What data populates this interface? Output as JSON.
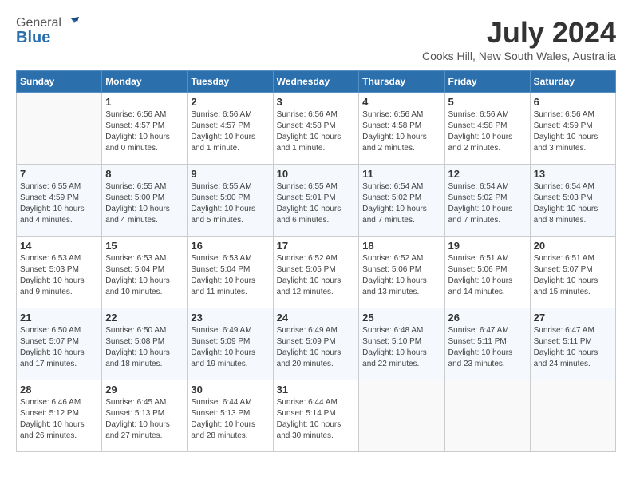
{
  "header": {
    "logo_general": "General",
    "logo_blue": "Blue",
    "month_year": "July 2024",
    "location": "Cooks Hill, New South Wales, Australia"
  },
  "columns": [
    "Sunday",
    "Monday",
    "Tuesday",
    "Wednesday",
    "Thursday",
    "Friday",
    "Saturday"
  ],
  "weeks": [
    [
      {
        "day": "",
        "info": ""
      },
      {
        "day": "1",
        "info": "Sunrise: 6:56 AM\nSunset: 4:57 PM\nDaylight: 10 hours\nand 0 minutes."
      },
      {
        "day": "2",
        "info": "Sunrise: 6:56 AM\nSunset: 4:57 PM\nDaylight: 10 hours\nand 1 minute."
      },
      {
        "day": "3",
        "info": "Sunrise: 6:56 AM\nSunset: 4:58 PM\nDaylight: 10 hours\nand 1 minute."
      },
      {
        "day": "4",
        "info": "Sunrise: 6:56 AM\nSunset: 4:58 PM\nDaylight: 10 hours\nand 2 minutes."
      },
      {
        "day": "5",
        "info": "Sunrise: 6:56 AM\nSunset: 4:58 PM\nDaylight: 10 hours\nand 2 minutes."
      },
      {
        "day": "6",
        "info": "Sunrise: 6:56 AM\nSunset: 4:59 PM\nDaylight: 10 hours\nand 3 minutes."
      }
    ],
    [
      {
        "day": "7",
        "info": "Sunrise: 6:55 AM\nSunset: 4:59 PM\nDaylight: 10 hours\nand 4 minutes."
      },
      {
        "day": "8",
        "info": "Sunrise: 6:55 AM\nSunset: 5:00 PM\nDaylight: 10 hours\nand 4 minutes."
      },
      {
        "day": "9",
        "info": "Sunrise: 6:55 AM\nSunset: 5:00 PM\nDaylight: 10 hours\nand 5 minutes."
      },
      {
        "day": "10",
        "info": "Sunrise: 6:55 AM\nSunset: 5:01 PM\nDaylight: 10 hours\nand 6 minutes."
      },
      {
        "day": "11",
        "info": "Sunrise: 6:54 AM\nSunset: 5:02 PM\nDaylight: 10 hours\nand 7 minutes."
      },
      {
        "day": "12",
        "info": "Sunrise: 6:54 AM\nSunset: 5:02 PM\nDaylight: 10 hours\nand 7 minutes."
      },
      {
        "day": "13",
        "info": "Sunrise: 6:54 AM\nSunset: 5:03 PM\nDaylight: 10 hours\nand 8 minutes."
      }
    ],
    [
      {
        "day": "14",
        "info": "Sunrise: 6:53 AM\nSunset: 5:03 PM\nDaylight: 10 hours\nand 9 minutes."
      },
      {
        "day": "15",
        "info": "Sunrise: 6:53 AM\nSunset: 5:04 PM\nDaylight: 10 hours\nand 10 minutes."
      },
      {
        "day": "16",
        "info": "Sunrise: 6:53 AM\nSunset: 5:04 PM\nDaylight: 10 hours\nand 11 minutes."
      },
      {
        "day": "17",
        "info": "Sunrise: 6:52 AM\nSunset: 5:05 PM\nDaylight: 10 hours\nand 12 minutes."
      },
      {
        "day": "18",
        "info": "Sunrise: 6:52 AM\nSunset: 5:06 PM\nDaylight: 10 hours\nand 13 minutes."
      },
      {
        "day": "19",
        "info": "Sunrise: 6:51 AM\nSunset: 5:06 PM\nDaylight: 10 hours\nand 14 minutes."
      },
      {
        "day": "20",
        "info": "Sunrise: 6:51 AM\nSunset: 5:07 PM\nDaylight: 10 hours\nand 15 minutes."
      }
    ],
    [
      {
        "day": "21",
        "info": "Sunrise: 6:50 AM\nSunset: 5:07 PM\nDaylight: 10 hours\nand 17 minutes."
      },
      {
        "day": "22",
        "info": "Sunrise: 6:50 AM\nSunset: 5:08 PM\nDaylight: 10 hours\nand 18 minutes."
      },
      {
        "day": "23",
        "info": "Sunrise: 6:49 AM\nSunset: 5:09 PM\nDaylight: 10 hours\nand 19 minutes."
      },
      {
        "day": "24",
        "info": "Sunrise: 6:49 AM\nSunset: 5:09 PM\nDaylight: 10 hours\nand 20 minutes."
      },
      {
        "day": "25",
        "info": "Sunrise: 6:48 AM\nSunset: 5:10 PM\nDaylight: 10 hours\nand 22 minutes."
      },
      {
        "day": "26",
        "info": "Sunrise: 6:47 AM\nSunset: 5:11 PM\nDaylight: 10 hours\nand 23 minutes."
      },
      {
        "day": "27",
        "info": "Sunrise: 6:47 AM\nSunset: 5:11 PM\nDaylight: 10 hours\nand 24 minutes."
      }
    ],
    [
      {
        "day": "28",
        "info": "Sunrise: 6:46 AM\nSunset: 5:12 PM\nDaylight: 10 hours\nand 26 minutes."
      },
      {
        "day": "29",
        "info": "Sunrise: 6:45 AM\nSunset: 5:13 PM\nDaylight: 10 hours\nand 27 minutes."
      },
      {
        "day": "30",
        "info": "Sunrise: 6:44 AM\nSunset: 5:13 PM\nDaylight: 10 hours\nand 28 minutes."
      },
      {
        "day": "31",
        "info": "Sunrise: 6:44 AM\nSunset: 5:14 PM\nDaylight: 10 hours\nand 30 minutes."
      },
      {
        "day": "",
        "info": ""
      },
      {
        "day": "",
        "info": ""
      },
      {
        "day": "",
        "info": ""
      }
    ]
  ]
}
